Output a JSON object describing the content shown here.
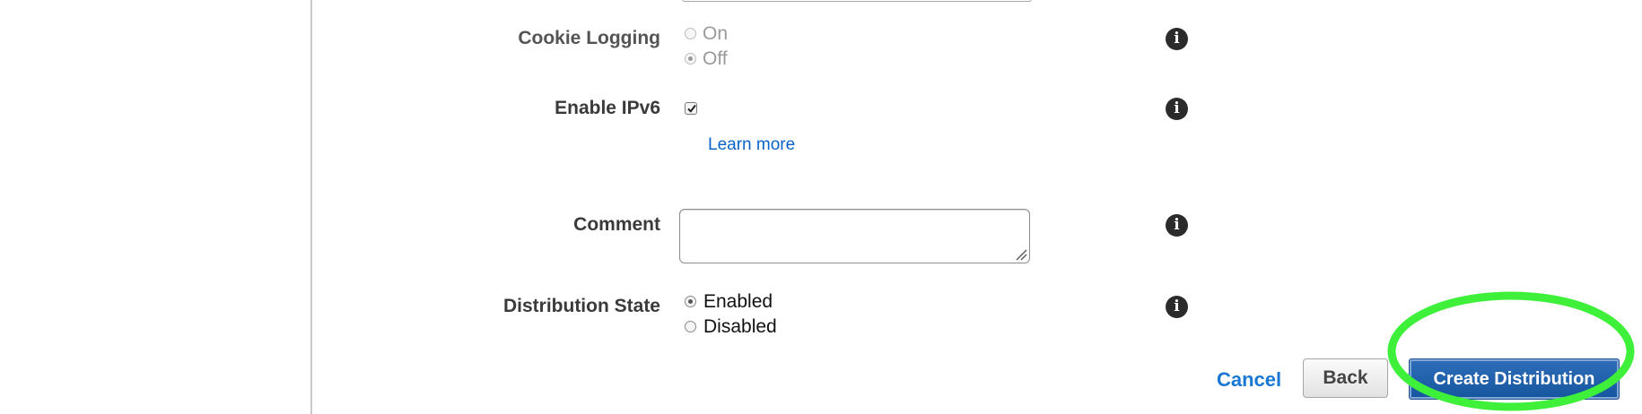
{
  "form": {
    "cookie_logging": {
      "label": "Cookie Logging",
      "options": [
        "On",
        "Off"
      ],
      "selected": "Off",
      "disabled": true
    },
    "enable_ipv6": {
      "label": "Enable IPv6",
      "checked": true,
      "learn_more": "Learn more"
    },
    "comment": {
      "label": "Comment",
      "value": ""
    },
    "distribution_state": {
      "label": "Distribution State",
      "options": [
        "Enabled",
        "Disabled"
      ],
      "selected": "Enabled"
    }
  },
  "actions": {
    "cancel_label": "Cancel",
    "back_label": "Back",
    "create_label": "Create Distribution"
  },
  "icons": {
    "info": "info-icon",
    "check": "check-icon",
    "resize": "resize-grip-icon"
  },
  "colors": {
    "link": "#0a63c7",
    "primary_button": "#1a5ca8",
    "highlight": "#3ef03a"
  }
}
